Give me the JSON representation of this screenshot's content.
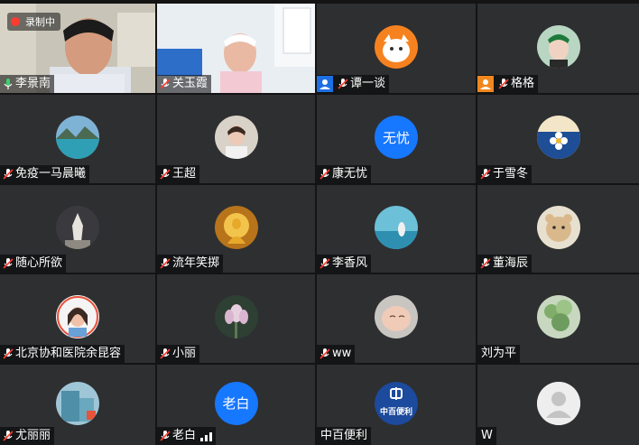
{
  "recording_label": "录制中",
  "participants": [
    {
      "name": "李景南",
      "mic": "on",
      "video": true
    },
    {
      "name": "关玉霞",
      "mic": "off",
      "video": true
    },
    {
      "name": "谭一谈",
      "mic": "off",
      "host": "blue",
      "avatar": "cat-avatar"
    },
    {
      "name": "格格",
      "mic": "off",
      "host": "orange",
      "avatar": "photo-avatar"
    },
    {
      "name": "免疫一马晨曦",
      "mic": "off",
      "avatar": "lake-avatar"
    },
    {
      "name": "王超",
      "mic": "off",
      "avatar": "portrait-avatar"
    },
    {
      "name": "康无忧",
      "mic": "off",
      "avatar_text": "无忧"
    },
    {
      "name": "于雪冬",
      "mic": "off",
      "avatar": "flower-avatar"
    },
    {
      "name": "随心所欲",
      "mic": "off",
      "avatar": "tower-avatar"
    },
    {
      "name": "流年笑掷",
      "mic": "off",
      "avatar": "buddha-avatar"
    },
    {
      "name": "李香风",
      "mic": "off",
      "avatar": "sea-avatar"
    },
    {
      "name": "董海辰",
      "mic": "off",
      "avatar": "bear-avatar"
    },
    {
      "name": "北京协和医院余昆容",
      "mic": "off",
      "avatar": "woman-avatar"
    },
    {
      "name": "小丽",
      "mic": "off",
      "avatar": "lotus-avatar"
    },
    {
      "name": "ww",
      "mic": "off",
      "avatar": "baby-avatar"
    },
    {
      "name": "刘为平",
      "mic": "none",
      "avatar": "plant-avatar"
    },
    {
      "name": "尤丽丽",
      "mic": "off",
      "avatar": "building-avatar"
    },
    {
      "name": "老白",
      "mic": "off",
      "avatar_text": "老白"
    },
    {
      "name": "中百便利",
      "mic": "none",
      "avatar": "store-logo-avatar"
    },
    {
      "name": "W",
      "mic": "none",
      "avatar": "default-avatar"
    }
  ],
  "store_logo_text": "中百便利",
  "colors": {
    "accent": "#1677ff",
    "tile": "#2e2f31",
    "speaking": "#33c26a",
    "record": "#ff3b30"
  }
}
